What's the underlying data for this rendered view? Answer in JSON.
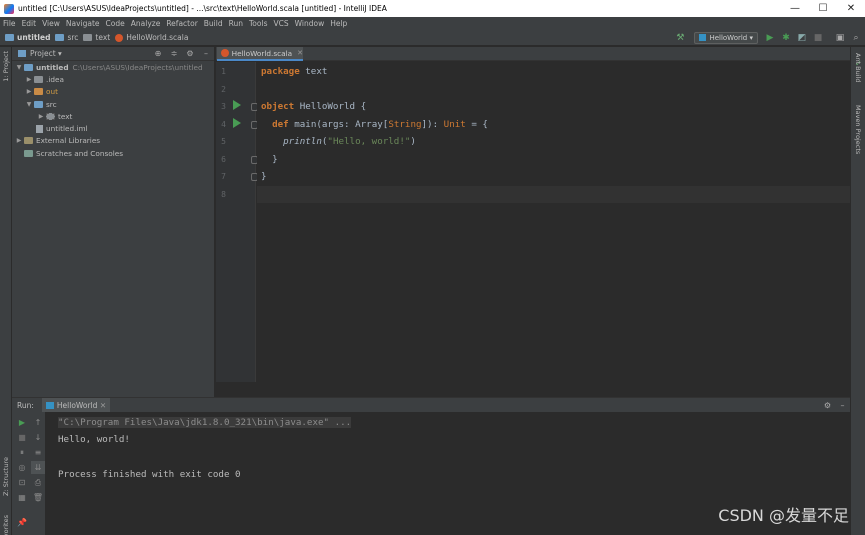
{
  "window": {
    "title": "untitled [C:\\Users\\ASUS\\IdeaProjects\\untitled] - ...\\src\\text\\HelloWorld.scala [untitled] - IntelliJ IDEA"
  },
  "menu": [
    "File",
    "Edit",
    "View",
    "Navigate",
    "Code",
    "Analyze",
    "Refactor",
    "Build",
    "Run",
    "Tools",
    "VCS",
    "Window",
    "Help"
  ],
  "breadcrumbs": [
    "untitled",
    "src",
    "text",
    "HelloWorld.scala"
  ],
  "run_config": "HelloWorld",
  "left_strip": {
    "project_tab": "1: Project",
    "structure_tab": "Z: Structure",
    "favorites_tab": "Favorites"
  },
  "right_strip": {
    "ant_build": "Ant Build",
    "maven": "Maven Projects"
  },
  "project": {
    "header": "Project",
    "root": {
      "name": "untitled",
      "path": "C:\\Users\\ASUS\\IdeaProjects\\untitled"
    },
    "items": [
      ".idea",
      "out",
      "src",
      "text",
      "untitled.iml",
      "External Libraries",
      "Scratches and Consoles"
    ]
  },
  "editor": {
    "tab": "HelloWorld.scala",
    "line_numbers": [
      "1",
      "2",
      "3",
      "4",
      "5",
      "6",
      "7",
      "8"
    ],
    "code": {
      "l1_kw": "package",
      "l1_rest": " text",
      "l3_kw": "object",
      "l3_name": " HelloWorld",
      "l3_rest": " {",
      "l4_kw": "def",
      "l4_name": " main",
      "l4_a": "(args: ",
      "l4_t": "Array",
      "l4_b": "[",
      "l4_s": "String",
      "l4_c": "]): ",
      "l4_u": "Unit",
      "l4_d": " = {",
      "l5_fn": "println",
      "l5_a": "(",
      "l5_str": "\"Hello, world!\"",
      "l5_b": ")",
      "l6": "}",
      "l7": "}"
    }
  },
  "run": {
    "label": "Run:",
    "tab": "HelloWorld",
    "console": [
      "\"C:\\Program Files\\Java\\jdk1.8.0_321\\bin\\java.exe\" ...",
      "Hello, world!",
      "",
      "Process finished with exit code 0"
    ]
  },
  "watermark": "CSDN @发量不足"
}
